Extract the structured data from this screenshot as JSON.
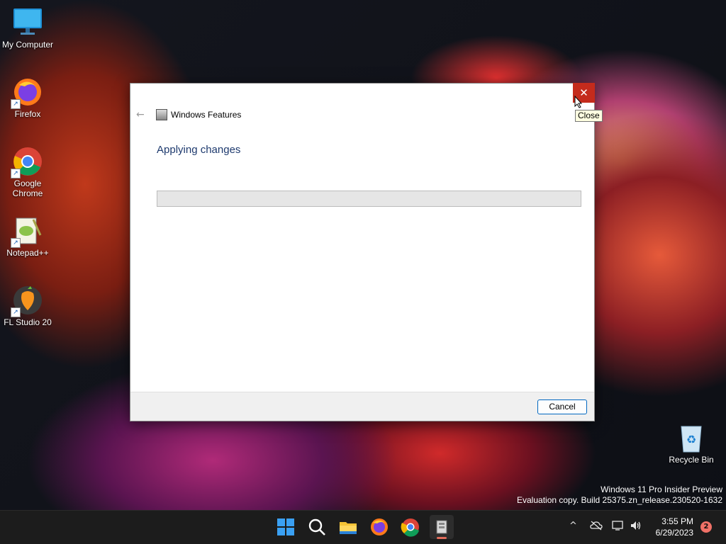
{
  "desktop": {
    "icons": [
      {
        "label": "My Computer"
      },
      {
        "label": "Firefox"
      },
      {
        "label": "Google Chrome"
      },
      {
        "label": "Notepad++"
      },
      {
        "label": "FL Studio 20"
      },
      {
        "label": "Recycle Bin"
      }
    ]
  },
  "dialog": {
    "title": "Windows Features",
    "heading": "Applying changes",
    "progress": 0,
    "cancel_label": "Cancel",
    "close_glyph": "✕",
    "close_tooltip": "Close",
    "back_glyph": "←"
  },
  "watermark": {
    "line1": "Windows 11 Pro Insider Preview",
    "line2": "Evaluation copy. Build 25375.zn_release.230520-1632"
  },
  "taskbar": {
    "items": [
      "start-icon",
      "search-icon",
      "file-explorer-icon",
      "firefox-icon",
      "chrome-icon",
      "windows-features-icon"
    ],
    "tray": {
      "chevron": "^",
      "time": "3:55 PM",
      "date": "6/29/2023",
      "notification_count": "2"
    }
  },
  "colors": {
    "close_red": "#c42b1c",
    "accent_blue": "#0067c0",
    "heading_blue": "#1e3a6e",
    "taskbar_bg": "#1c1c1c"
  }
}
